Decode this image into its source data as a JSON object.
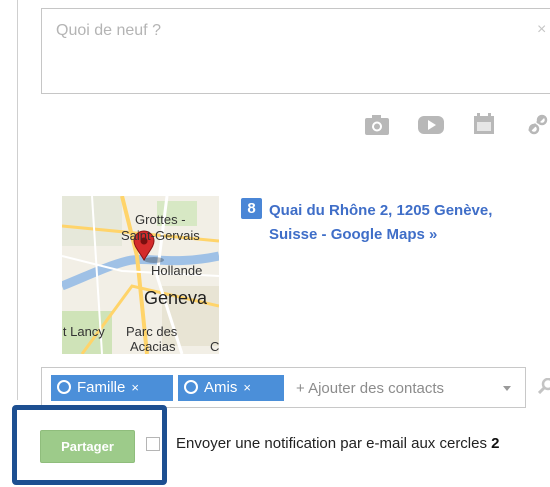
{
  "composer": {
    "placeholder": "Quoi de neuf ?",
    "close": "×"
  },
  "media_icons": [
    "camera-icon",
    "video-icon",
    "calendar-icon",
    "link-icon"
  ],
  "map": {
    "labels": [
      "Grottes -",
      "Saint-Gervais",
      "Hollande",
      "Geneva",
      "it Lancy",
      "Parc des",
      "Acacias",
      "C"
    ]
  },
  "place": {
    "icon_letter": "8",
    "link_text": "Quai du Rhône 2, 1205 Genève, Suisse - Google Maps »"
  },
  "share_with": {
    "chips": [
      {
        "label": "Famille",
        "remove": "×"
      },
      {
        "label": "Amis",
        "remove": "×"
      }
    ],
    "add_placeholder": "+ Ajouter des contacts"
  },
  "footer": {
    "share_button": "Partager",
    "notify_text": "Envoyer une notification par e-mail aux cercles",
    "notify_count": "2"
  },
  "colors": {
    "chip_blue": "#4b8fd9",
    "link_blue": "#3f6ec8",
    "share_green": "#9dcb8a",
    "highlight_navy": "#1d4f91"
  }
}
